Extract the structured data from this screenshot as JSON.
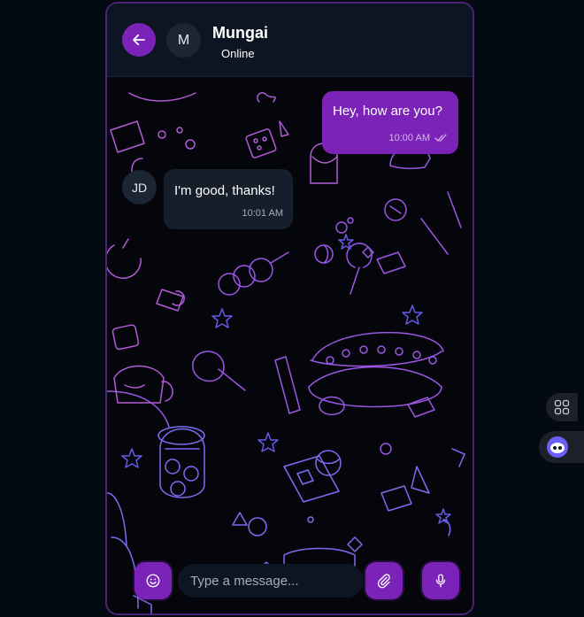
{
  "header": {
    "back_icon": "arrow-left-icon",
    "avatar_initial": "M",
    "name": "Mungai",
    "status": "Online"
  },
  "messages": [
    {
      "direction": "outgoing",
      "text": "Hey, how are you?",
      "time": "10:00 AM",
      "status_icon": "double-check-icon"
    },
    {
      "direction": "incoming",
      "avatar_initials": "JD",
      "text": "I'm good, thanks!",
      "time": "10:01 AM"
    }
  ],
  "composer": {
    "emoji_icon": "smiley-icon",
    "placeholder": "Type a message...",
    "attach_icon": "paperclip-icon",
    "mic_icon": "microphone-icon"
  },
  "side_widgets": {
    "apps_icon": "grid-icon",
    "assistant_icon": "bot-face-icon"
  },
  "colors": {
    "accent": "#7b22b8",
    "header_bg": "#0d1522",
    "incoming_bubble": "#161e2b",
    "page_bg": "#030a14",
    "phone_border": "#4a2378",
    "doodle_stroke": "#8a5cf0"
  }
}
